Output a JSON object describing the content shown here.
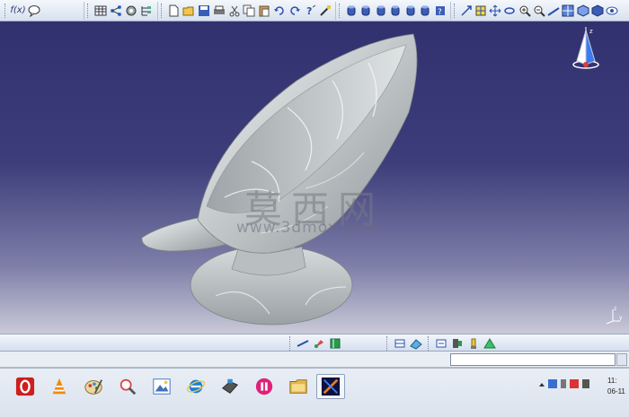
{
  "app": {
    "accent_color": "#2f3f8f",
    "viewport_gradient": [
      "#31316f",
      "#c9c9d8"
    ]
  },
  "top_toolbar": {
    "groups": [
      {
        "name": "formula",
        "icons": [
          "formula-icon",
          "comment-icon"
        ]
      },
      {
        "name": "catalog",
        "icons": [
          "table-icon",
          "tree-icon",
          "settings-icon",
          "tree-expand-icon"
        ]
      },
      {
        "name": "standard",
        "icons": [
          "new-file-icon",
          "open-folder-icon",
          "save-icon",
          "print-icon",
          "cut-icon",
          "copy-icon",
          "paste-icon",
          "undo-icon",
          "redo-icon",
          "help-icon"
        ]
      },
      {
        "name": "apps",
        "icons": [
          "cylinder-icon",
          "cylinder-icon",
          "cylinder-icon",
          "cylinder-icon",
          "cylinder-icon",
          "cylinder-icon",
          "help-icon"
        ]
      },
      {
        "name": "view",
        "icons": [
          "fly-icon",
          "fit-all-icon",
          "pan-icon",
          "rotate-icon",
          "zoom-in-icon",
          "zoom-out-icon",
          "normal-view-icon",
          "multi-view-icon",
          "iso-view-icon",
          "shading-icon",
          "hide-show-icon"
        ]
      }
    ]
  },
  "bottom_toolbar": {
    "group_a": [
      "measure-icon",
      "apply-material-icon",
      "analysis-icon"
    ],
    "group_b": [
      "snap-icon",
      "render-icon"
    ],
    "group_c": [
      "constraint-icon",
      "compass-icon",
      "lamp-icon",
      "shape-icon"
    ]
  },
  "status_bar": {
    "power_input_value": ""
  },
  "taskbar": {
    "apps": [
      {
        "name": "opera",
        "color": "#cc1f1f"
      },
      {
        "name": "vlc",
        "color": "#f08a00"
      },
      {
        "name": "paint",
        "color": "#3a8fd6"
      },
      {
        "name": "search",
        "color": "#d64a4a"
      },
      {
        "name": "picture",
        "color": "#3d72c0"
      },
      {
        "name": "ie",
        "color": "#1d7fd6"
      },
      {
        "name": "mouse",
        "color": "#555"
      },
      {
        "name": "music",
        "color": "#e0207a"
      },
      {
        "name": "folder",
        "color": "#e2b74a"
      },
      {
        "name": "catia",
        "color": "#1d2a68"
      }
    ],
    "clock_time": "11:",
    "clock_date": "06-11"
  },
  "watermark": {
    "chinese": "莫西网",
    "url": "www.3dmox.com"
  },
  "compass_label": "z",
  "axis_labels": {
    "z": "z",
    "y": "y",
    "x": "x"
  }
}
